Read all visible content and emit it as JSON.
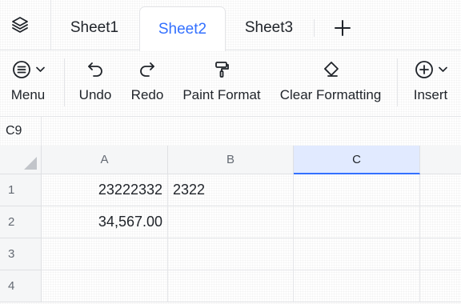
{
  "tabs": {
    "items": [
      {
        "label": "Sheet1",
        "active": false
      },
      {
        "label": "Sheet2",
        "active": true
      },
      {
        "label": "Sheet3",
        "active": false
      }
    ],
    "icons": {
      "layers": "layers-icon",
      "add": "plus-icon"
    }
  },
  "toolbar": {
    "menu_label": "Menu",
    "undo_label": "Undo",
    "redo_label": "Redo",
    "paint_format_label": "Paint Format",
    "clear_formatting_label": "Clear Formatting",
    "insert_label": "Insert",
    "icons": {
      "menu": "menu-icon",
      "undo": "undo-icon",
      "redo": "redo-icon",
      "paint_format": "paint-roller-icon",
      "clear_formatting": "eraser-icon",
      "insert": "plus-circle-icon",
      "dropdown": "chevron-down-icon"
    }
  },
  "name_box": {
    "value": "C9"
  },
  "sheet": {
    "columns": [
      "A",
      "B",
      "C"
    ],
    "selected_column": "C",
    "rows": [
      {
        "label": "1",
        "cells": [
          "23222332",
          "2322",
          ""
        ]
      },
      {
        "label": "2",
        "cells": [
          "34,567.00",
          "",
          ""
        ]
      },
      {
        "label": "3",
        "cells": [
          "",
          "",
          ""
        ]
      },
      {
        "label": "4",
        "cells": [
          "",
          "",
          ""
        ]
      }
    ]
  },
  "colors": {
    "accent": "#3370ff",
    "text": "#1f2329",
    "border": "#e4e5e8",
    "header_text": "#646a73",
    "selected_header": "#e1eaff"
  }
}
